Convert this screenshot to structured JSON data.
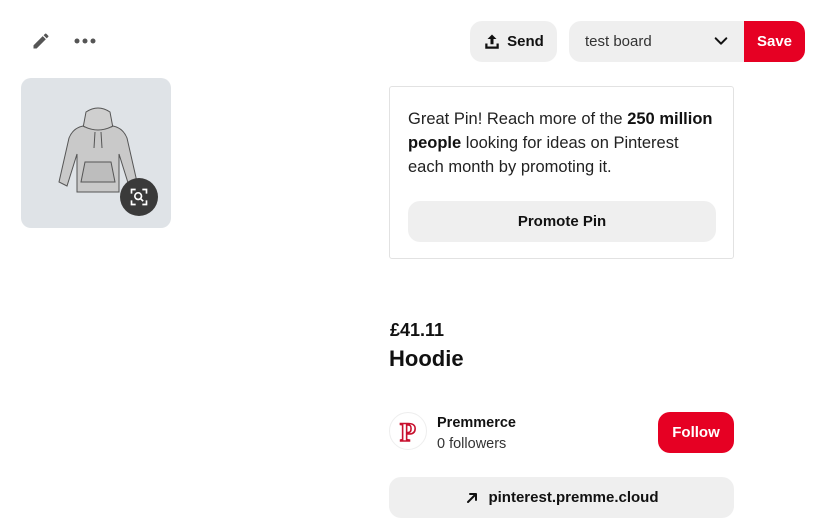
{
  "toolbar": {
    "edit_icon": "pencil-icon",
    "more_icon": "more-dots-icon",
    "send_label": "Send",
    "board_value": "test board",
    "save_label": "Save"
  },
  "promo": {
    "text_before": "Great Pin! Reach more of the ",
    "text_bold": "250 million people",
    "text_after": " looking for ideas on Pinterest each month by promoting it.",
    "button_label": "Promote Pin"
  },
  "product": {
    "price": "£41.11",
    "title": "Hoodie"
  },
  "creator": {
    "name": "Premmerce",
    "followers": "0 followers",
    "follow_label": "Follow",
    "avatar_letter": "P"
  },
  "link": {
    "label": "pinterest.premme.cloud"
  },
  "colors": {
    "accent": "#e60023",
    "button_gray": "#efefef"
  }
}
